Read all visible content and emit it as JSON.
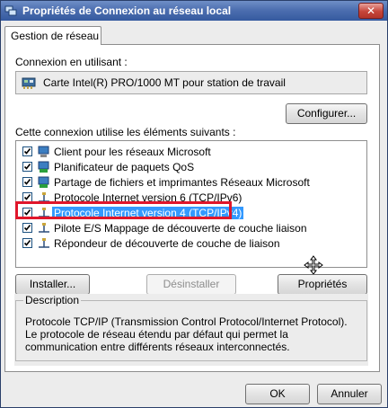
{
  "window": {
    "title": "Propriétés de Connexion au réseau local",
    "close_label": "✕"
  },
  "tabs": [
    {
      "label": "Gestion de réseau",
      "selected": true
    }
  ],
  "connection": {
    "label": "Connexion en utilisant :",
    "adapter": "Carte Intel(R) PRO/1000 MT pour station de travail",
    "configure_button": "Configurer..."
  },
  "items_section": {
    "label": "Cette connexion utilise les éléments suivants :",
    "items": [
      {
        "label": "Client pour les réseaux Microsoft",
        "checked": true,
        "icon": "network-client-icon"
      },
      {
        "label": "Planificateur de paquets QoS",
        "checked": true,
        "icon": "network-service-icon"
      },
      {
        "label": "Partage de fichiers et imprimantes Réseaux Microsoft",
        "checked": true,
        "icon": "network-service-icon"
      },
      {
        "label": "Protocole Internet version 6 (TCP/IPv6)",
        "checked": true,
        "icon": "protocol-icon"
      },
      {
        "label": "Protocole Internet version 4 (TCP/IPv4)",
        "checked": true,
        "icon": "protocol-icon",
        "selected": true
      },
      {
        "label": "Pilote E/S Mappage de découverte de couche liaison",
        "checked": true,
        "icon": "protocol-icon"
      },
      {
        "label": "Répondeur de découverte de couche de liaison",
        "checked": true,
        "icon": "protocol-icon"
      }
    ]
  },
  "buttons": {
    "install": "Installer...",
    "uninstall": "Désinstaller",
    "properties": "Propriétés",
    "ok": "OK",
    "cancel": "Annuler"
  },
  "description": {
    "legend": "Description",
    "text": "Protocole TCP/IP (Transmission Control Protocol/Internet Protocol). Le protocole de réseau étendu par défaut qui permet la communication entre différents réseaux interconnectés."
  },
  "colors": {
    "title_bar": "#4d6fb0",
    "selection": "#3399ff",
    "highlight_box": "#e0162b"
  }
}
